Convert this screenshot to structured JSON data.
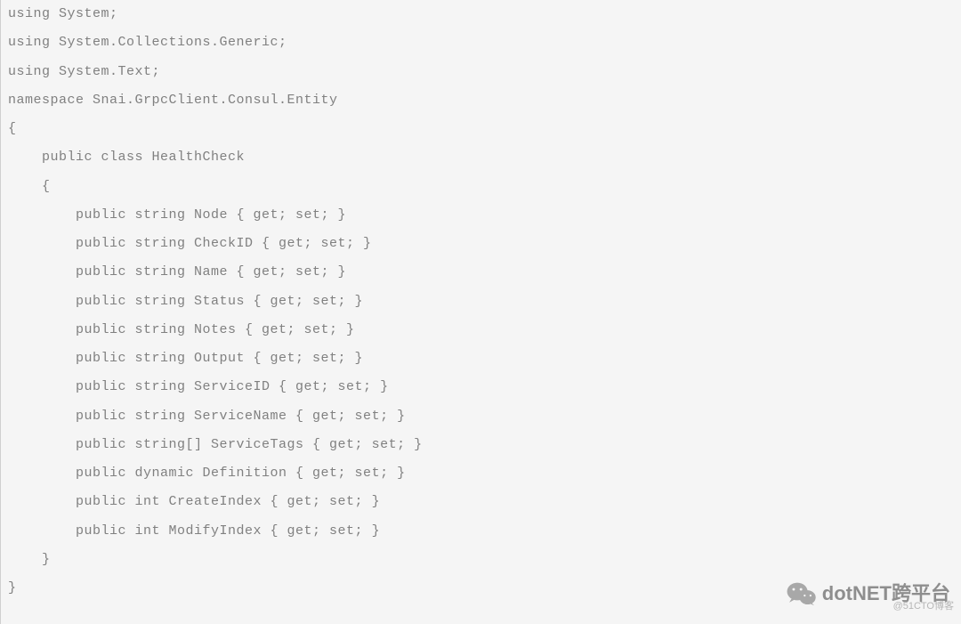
{
  "code": {
    "lines": [
      "using System;",
      "using System.Collections.Generic;",
      "using System.Text;",
      "",
      "namespace Snai.GrpcClient.Consul.Entity",
      "{",
      "    public class HealthCheck",
      "    {",
      "        public string Node { get; set; }",
      "        public string CheckID { get; set; }",
      "        public string Name { get; set; }",
      "        public string Status { get; set; }",
      "        public string Notes { get; set; }",
      "        public string Output { get; set; }",
      "        public string ServiceID { get; set; }",
      "        public string ServiceName { get; set; }",
      "        public string[] ServiceTags { get; set; }",
      "        public dynamic Definition { get; set; }",
      "        public int CreateIndex { get; set; }",
      "        public int ModifyIndex { get; set; }",
      "    }",
      "}"
    ]
  },
  "watermark": {
    "text": "dotNET跨平台",
    "credit": "@51CTO博客"
  }
}
